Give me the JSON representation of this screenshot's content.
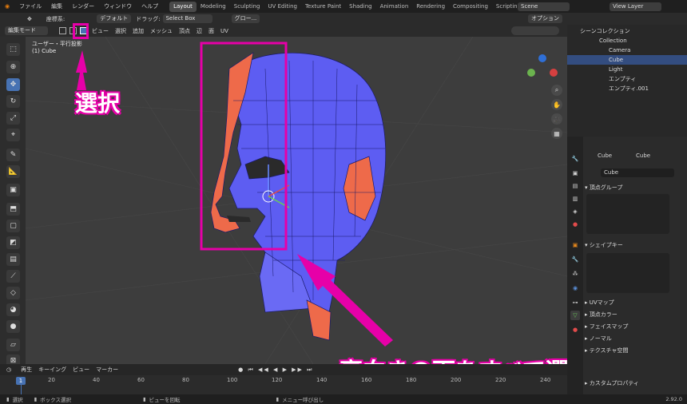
{
  "topbar": {
    "menus": [
      "ファイル",
      "編集",
      "レンダー",
      "ウィンドウ",
      "ヘルプ"
    ],
    "workspaces": [
      "Layout",
      "Modeling",
      "Sculpting",
      "UV Editing",
      "Texture Paint",
      "Shading",
      "Animation",
      "Rendering",
      "Compositing",
      "Scripting"
    ],
    "active_workspace": "Layout",
    "scene": "Scene",
    "view_layer": "View Layer"
  },
  "header2": {
    "orientation_label": "座標系:",
    "orientation_value": "デフォルト",
    "drag_label": "ドラッグ:",
    "drag_value": "Select Box",
    "global": "グロー...",
    "options": "オプション"
  },
  "header3": {
    "mode": "編集モード",
    "menus": [
      "ビュー",
      "選択",
      "追加",
      "メッシュ",
      "頂点",
      "辺",
      "面",
      "UV"
    ]
  },
  "viewport": {
    "view_name": "ユーザー・平行投影",
    "object_name": "(1) Cube"
  },
  "annotations": {
    "select_label": "選択",
    "main_caption": "裏向きの面をすべて選択する"
  },
  "outliner": {
    "title": "シーンコレクション",
    "items": [
      {
        "label": "Collection"
      },
      {
        "label": "Camera"
      },
      {
        "label": "Cube"
      },
      {
        "label": "Light"
      },
      {
        "label": "エンプティ"
      },
      {
        "label": "エンプティ.001"
      }
    ]
  },
  "properties": {
    "object": "Cube",
    "mesh": "Cube",
    "data_name": "Cube",
    "panels": {
      "vertex_groups": "頂点グループ",
      "shape_keys": "シェイプキー",
      "uv_maps": "UVマップ",
      "vertex_colors": "頂点カラー",
      "face_maps": "フェイスマップ",
      "normals": "ノーマル",
      "texture_space": "テクスチャ空間",
      "custom_props": "カスタムプロパティ"
    }
  },
  "timeline": {
    "menus": [
      "再生",
      "キーイング",
      "ビュー",
      "マーカー"
    ],
    "current_frame": "1",
    "ticks": [
      "20",
      "40",
      "60",
      "80",
      "100",
      "120",
      "140",
      "160",
      "180",
      "200",
      "220",
      "240"
    ]
  },
  "status": {
    "select": "選択",
    "box_select": "ボックス選択",
    "rotate_view": "ビューを回転",
    "call_menu": "メニュー呼び出し",
    "version": "2.92.0"
  },
  "colors": {
    "selected_face": "#5c5cf0",
    "back_face": "#ee6a4a",
    "accent": "#e600a8"
  }
}
